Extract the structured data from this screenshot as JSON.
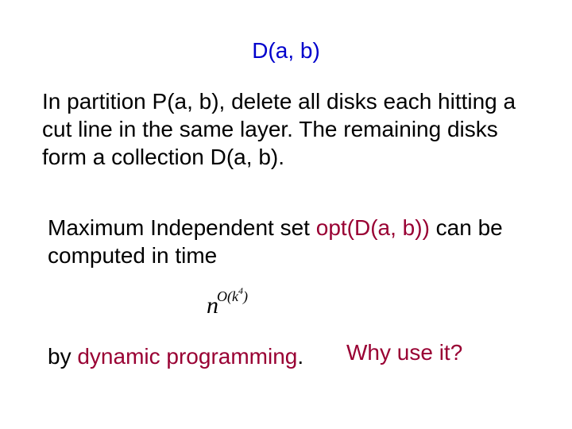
{
  "title": "D(a, b)",
  "paragraph1": "In partition P(a, b), delete all disks each hitting a cut line in the same layer. The remaining disks form a collection D(a, b).",
  "paragraph2_prefix": "Maximum Independent set ",
  "paragraph2_opt": "opt(D(a, b))",
  "paragraph2_suffix": " can be computed in time",
  "formula_base": "n",
  "formula_exp_prefix": "O(k",
  "formula_exp_sup": "4",
  "formula_exp_suffix": ")",
  "paragraph3_prefix": "by ",
  "paragraph3_dp": "dynamic programming",
  "paragraph3_suffix": ".",
  "why": "Why use it?"
}
